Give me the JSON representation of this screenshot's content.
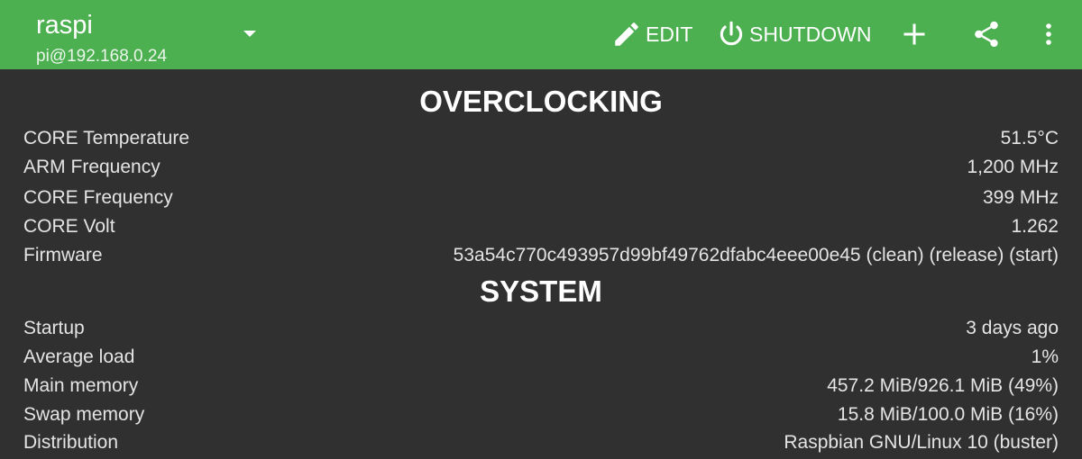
{
  "header": {
    "host_name": "raspi",
    "host_address": "pi@192.168.0.24",
    "edit_label": "EDIT",
    "shutdown_label": "SHUTDOWN",
    "icons": {
      "dropdown": "chevron-down-icon",
      "edit": "pencil-icon",
      "shutdown": "power-icon",
      "add": "plus-icon",
      "share": "share-icon",
      "more": "more-vert-icon"
    },
    "bar_color": "#4caf50"
  },
  "overclocking": {
    "title": "OVERCLOCKING",
    "rows": [
      {
        "label": "CORE Temperature",
        "value": "51.5°C"
      },
      {
        "label": "ARM Frequency",
        "value": "1,200 MHz"
      },
      {
        "label": "CORE Frequency",
        "value": "399 MHz"
      },
      {
        "label": "CORE Volt",
        "value": "1.262"
      },
      {
        "label": "Firmware",
        "value": "53a54c770c493957d99bf49762dfabc4eee00e45 (clean) (release) (start)"
      }
    ]
  },
  "system": {
    "title": "SYSTEM",
    "rows": [
      {
        "label": "Startup",
        "value": "3 days ago"
      },
      {
        "label": "Average load",
        "value": "1%"
      },
      {
        "label": "Main memory",
        "value": "457.2 MiB/926.1 MiB (49%)"
      },
      {
        "label": "Swap memory",
        "value": "15.8 MiB/100.0 MiB (16%)"
      },
      {
        "label": "Distribution",
        "value": "Raspbian GNU/Linux 10 (buster)"
      }
    ]
  },
  "background_color": "#303030"
}
